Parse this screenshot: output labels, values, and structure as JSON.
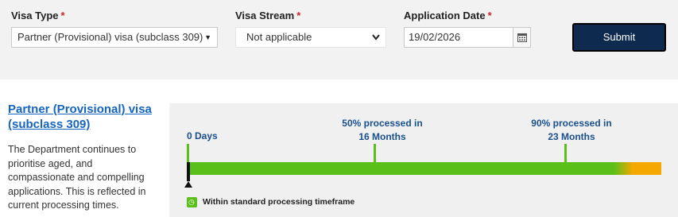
{
  "form": {
    "visa_type": {
      "label": "Visa Type",
      "required": "*",
      "value": "Partner (Provisional) visa (subclass 309)"
    },
    "visa_stream": {
      "label": "Visa Stream",
      "required": "*",
      "value": "Not applicable"
    },
    "application_date": {
      "label": "Application Date",
      "required": "*",
      "value": "19/02/2026"
    },
    "submit_label": "Submit"
  },
  "result": {
    "title": "Partner (Provisional) visa (subclass 309)",
    "description": "The Department continues to prioritise aged, and compassionate and compelling applications. This is reflected in current processing times."
  },
  "timeline": {
    "start_label": "0 Days",
    "p50_label_line1": "50% processed in",
    "p50_label_line2": "16 Months",
    "p90_label_line1": "90% processed in",
    "p90_label_line2": "23 Months",
    "legend_text": "Within standard processing timeframe",
    "colors": {
      "within": "#5bbf1a",
      "beyond": "#f5a800"
    }
  },
  "icons": {
    "calendar": "calendar-icon",
    "legend": "clock-icon",
    "dropdown": "chevron-down-icon"
  }
}
